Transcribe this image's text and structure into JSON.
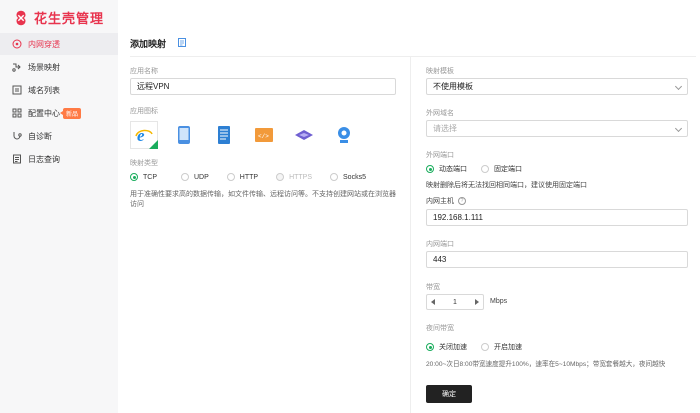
{
  "app": {
    "title": "花生壳管理"
  },
  "sidebar": {
    "items": [
      {
        "label": "内网穿透",
        "icon": "network-icon",
        "active": true
      },
      {
        "label": "场景映射",
        "icon": "scene-icon"
      },
      {
        "label": "域名列表",
        "icon": "domain-list-icon"
      },
      {
        "label": "配置中心",
        "icon": "config-grid-icon",
        "badge": "新品"
      },
      {
        "label": "自诊断",
        "icon": "diagnose-icon"
      },
      {
        "label": "日志查询",
        "icon": "log-icon"
      }
    ]
  },
  "page": {
    "title": "添加映射"
  },
  "left": {
    "app_name_label": "应用名称",
    "app_name_value": "远程VPN",
    "app_icon_label": "应用图标",
    "app_icons": [
      "ie-browser-icon",
      "mobile-icon",
      "document-icon",
      "html-icon",
      "layers-icon",
      "webcam-icon"
    ],
    "map_type_label": "映射类型",
    "map_types": [
      {
        "label": "TCP",
        "checked": true
      },
      {
        "label": "UDP"
      },
      {
        "label": "HTTP"
      },
      {
        "label": "HTTPS",
        "disabled": true
      },
      {
        "label": "Socks5"
      }
    ],
    "description": "用于准确性要求高的数据传输，如文件传输、远程访问等。不支持创建网站或在浏览器访问"
  },
  "right": {
    "template_label": "映射模板",
    "template_value": "不使用模板",
    "ext_domain_label": "外网域名",
    "ext_domain_placeholder": "请选择",
    "ext_port_label": "外网端口",
    "ext_port_options": [
      {
        "label": "动态端口",
        "checked": true
      },
      {
        "label": "固定端口"
      }
    ],
    "ext_port_hint": "映射删除后将无法找回相同端口，建议使用固定端口",
    "inner_host_label": "内网主机",
    "inner_host_value": "192.168.1.111",
    "inner_port_label": "内网端口",
    "inner_port_value": "443",
    "bandwidth_label": "带宽",
    "bandwidth_value": "1",
    "bandwidth_unit": "Mbps",
    "night_label": "夜间带宽",
    "night_options": [
      {
        "label": "关闭加速",
        "checked": true
      },
      {
        "label": "开启加速"
      }
    ],
    "night_hint": "20:00~次日8:00带宽速度提升100%，速率在5~10Mbps；带宽套餐越大，夜间越快",
    "confirm_label": "确定"
  },
  "colors": {
    "brand": "#e8344e",
    "accent": "#1aad5d",
    "badge": "#ff7a45"
  }
}
